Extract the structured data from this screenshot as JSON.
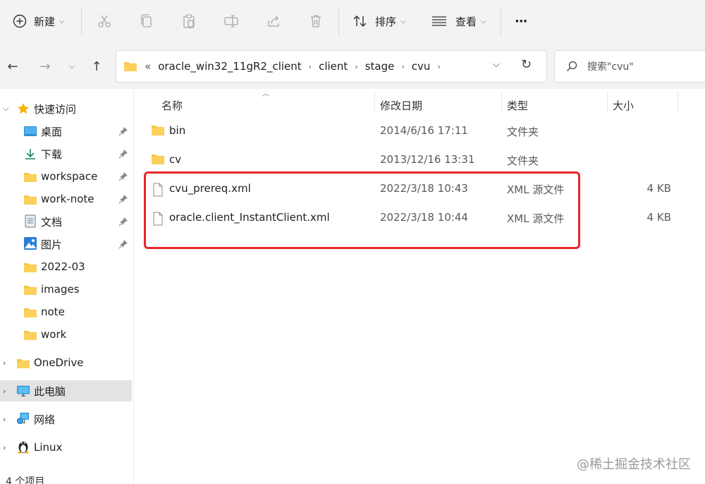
{
  "toolbar": {
    "new_label": "新建",
    "sort_label": "排序",
    "view_label": "查看",
    "more_label": "···",
    "icons": [
      "cut-icon",
      "copy-icon",
      "paste-icon",
      "rename-icon",
      "share-icon",
      "delete-icon"
    ]
  },
  "address": {
    "overflow": "«",
    "crumbs": [
      "oracle_win32_11gR2_client",
      "client",
      "stage",
      "cvu"
    ],
    "search_placeholder": "搜索\"cvu\""
  },
  "sidebar": {
    "quick_access": "快速访问",
    "items": [
      {
        "label": "桌面",
        "icon": "desktop-icon",
        "pinned": true
      },
      {
        "label": "下载",
        "icon": "download-icon",
        "pinned": true
      },
      {
        "label": "workspace",
        "icon": "folder-icon",
        "pinned": true
      },
      {
        "label": "work-note",
        "icon": "folder-icon",
        "pinned": true
      },
      {
        "label": "文档",
        "icon": "documents-icon",
        "pinned": true
      },
      {
        "label": "图片",
        "icon": "pictures-icon",
        "pinned": true
      },
      {
        "label": "2022-03",
        "icon": "folder-icon",
        "pinned": false
      },
      {
        "label": "images",
        "icon": "folder-icon",
        "pinned": false
      },
      {
        "label": "note",
        "icon": "folder-icon",
        "pinned": false
      },
      {
        "label": "work",
        "icon": "folder-icon",
        "pinned": false
      }
    ],
    "onedrive": "OneDrive",
    "this_pc": "此电脑",
    "network": "网络",
    "linux": "Linux"
  },
  "columns": {
    "name": "名称",
    "date": "修改日期",
    "type": "类型",
    "size": "大小"
  },
  "files": [
    {
      "name": "bin",
      "date": "2014/6/16 17:11",
      "type": "文件夹",
      "size": "",
      "kind": "folder"
    },
    {
      "name": "cv",
      "date": "2013/12/16 13:31",
      "type": "文件夹",
      "size": "",
      "kind": "folder"
    },
    {
      "name": "cvu_prereq.xml",
      "date": "2022/3/18 10:43",
      "type": "XML 源文件",
      "size": "4 KB",
      "kind": "file"
    },
    {
      "name": "oracle.client_InstantClient.xml",
      "date": "2022/3/18 10:44",
      "type": "XML 源文件",
      "size": "4 KB",
      "kind": "file"
    }
  ],
  "status": {
    "item_count": "4 个项目"
  },
  "watermark": "@稀土掘金技术社区",
  "colors": {
    "highlight": "#e8262a",
    "folder": "#f8c543",
    "selected": "#e3e3e3"
  }
}
